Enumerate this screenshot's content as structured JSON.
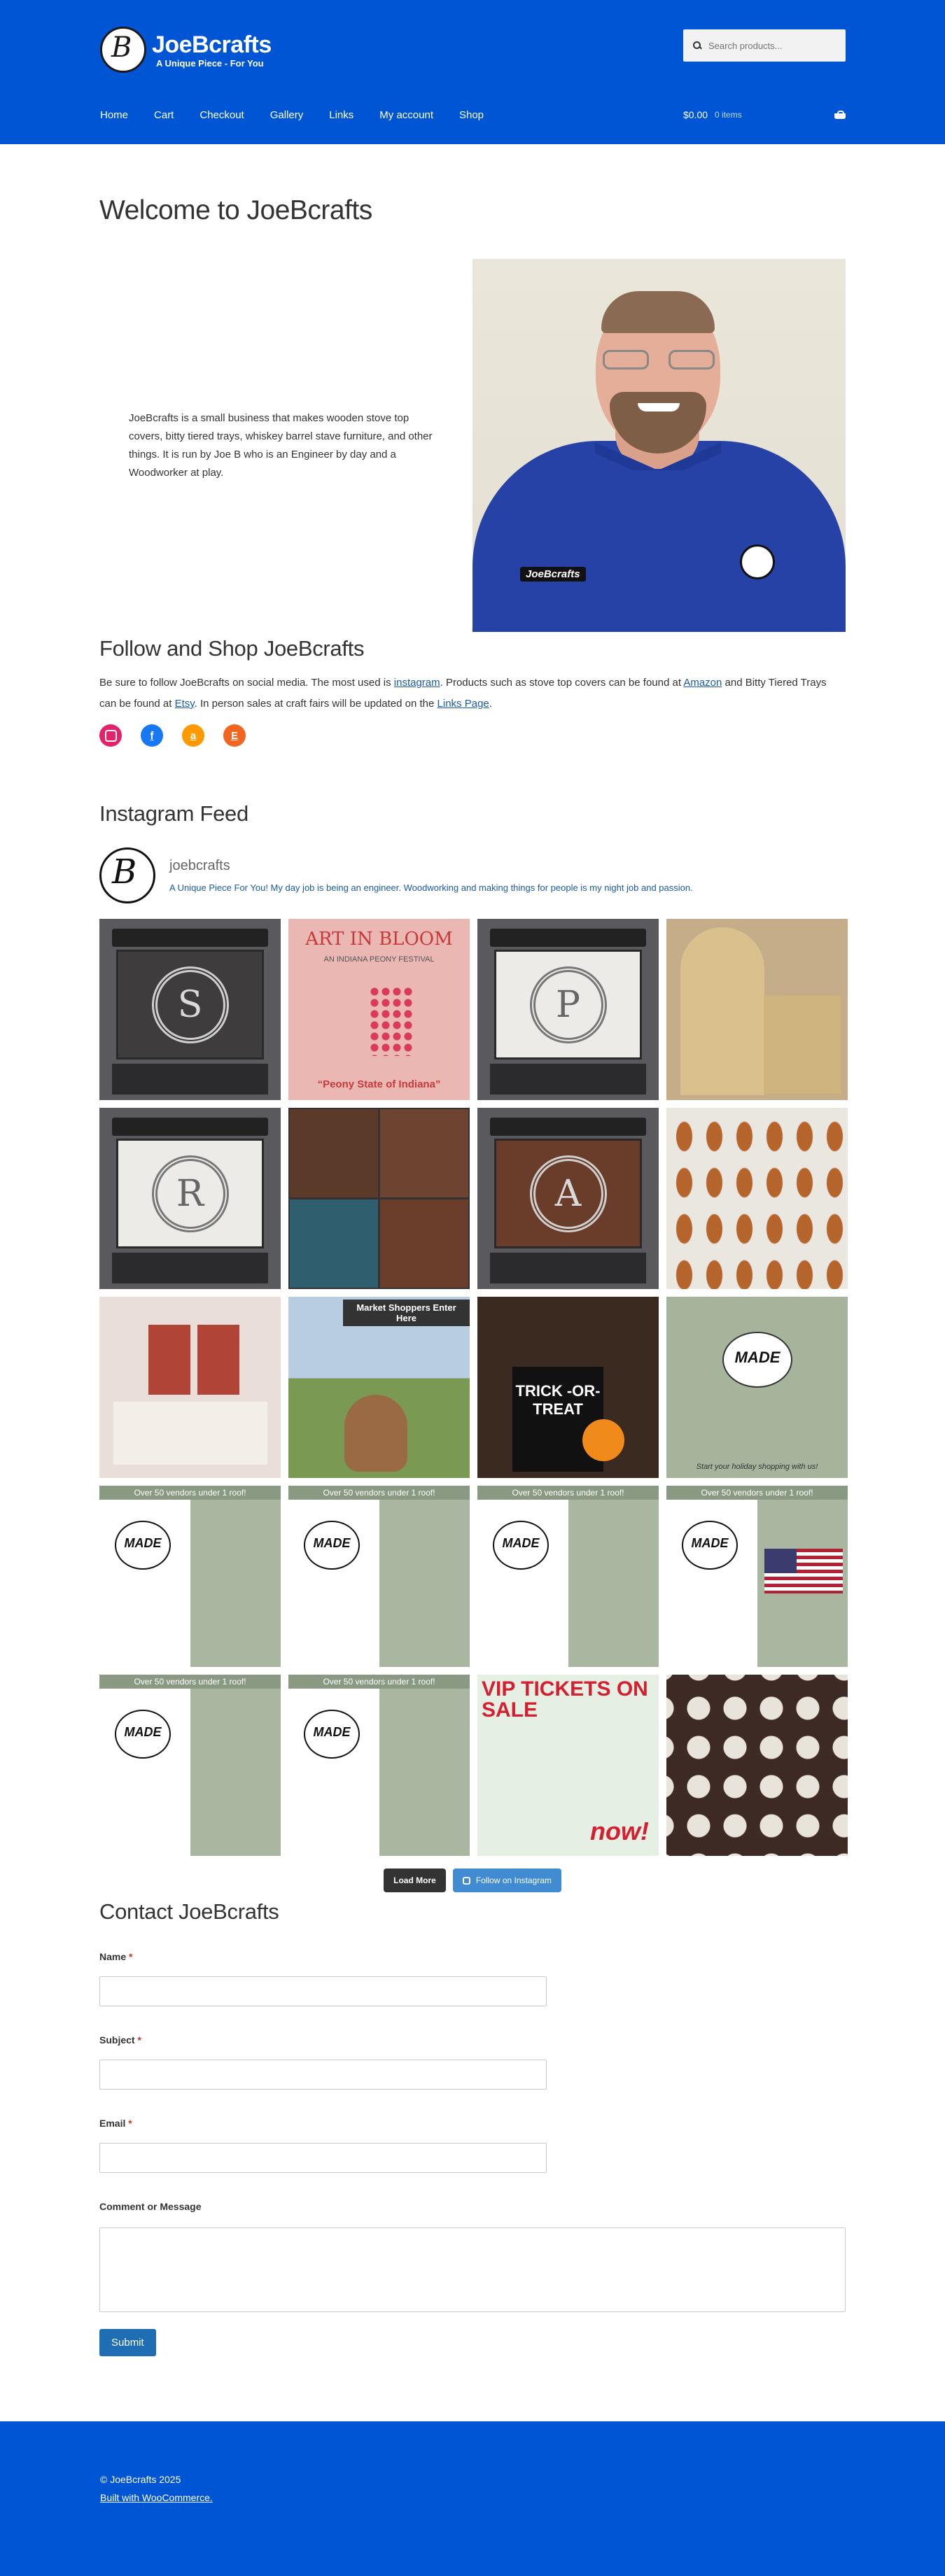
{
  "header": {
    "site_title": "JoeBcrafts",
    "tagline": "A Unique Piece - For You",
    "search_placeholder": "Search products...",
    "nav": [
      "Home",
      "Cart",
      "Checkout",
      "Gallery",
      "Links",
      "My account",
      "Shop"
    ],
    "cart_amount": "$0.00",
    "cart_count": "0 items"
  },
  "main": {
    "title": "Welcome to JoeBcrafts",
    "intro": "JoeBcrafts is a small business that makes wooden stove top covers, bitty tiered trays, whiskey barrel stave furniture, and other things. It is run by Joe B who is an Engineer by day and a Woodworker at play.",
    "photo_badge": "JoeBcrafts"
  },
  "follow": {
    "title": "Follow and Shop JoeBcrafts",
    "text_1": "Be sure to follow JoeBcrafts on social media. The most used is ",
    "link_instagram": "instagram",
    "text_2": ". Products such as stove top covers can be found at ",
    "link_amazon": "Amazon",
    "text_3": " and Bitty Tiered Trays can be found at ",
    "link_etsy": "Etsy",
    "text_4": ". In person sales at craft fairs will be updated on the ",
    "link_links": "Links Page",
    "text_5": ".",
    "socials": [
      "instagram",
      "facebook",
      "amazon",
      "etsy"
    ]
  },
  "instagram": {
    "title": "Instagram Feed",
    "username": "joebcrafts",
    "bio": "A Unique Piece For You! My day job is being an engineer. Woodworking and making things for people is my night job and passion.",
    "posts": {
      "art_in_bloom": "ART IN BLOOM",
      "festival": "AN INDIANA PEONY FESTIVAL",
      "peony_state": "“Peony State of Indiana”",
      "market_shoppers": "Market Shoppers Enter Here",
      "trick_or_treat": "TRICK -OR- TREAT",
      "made": "MADE",
      "over_50": "Over 50 vendors under 1 roof!",
      "start_shopping": "Start your holiday shopping with us!",
      "vip": "VIP TICKETS ON SALE",
      "now": "now!"
    },
    "load_more": "Load More",
    "follow": "Follow on Instagram"
  },
  "contact": {
    "title": "Contact JoeBcrafts",
    "name_label": "Name",
    "subject_label": "Subject",
    "email_label": "Email",
    "message_label": "Comment or Message",
    "required": "*",
    "submit": "Submit"
  },
  "footer": {
    "copyright": "© JoeBcrafts 2025",
    "built_with": "Built with WooCommerce."
  },
  "colors": {
    "header_bg": "#0055d4",
    "link": "#1b5aa8",
    "submit_bg": "#1f6db3"
  }
}
